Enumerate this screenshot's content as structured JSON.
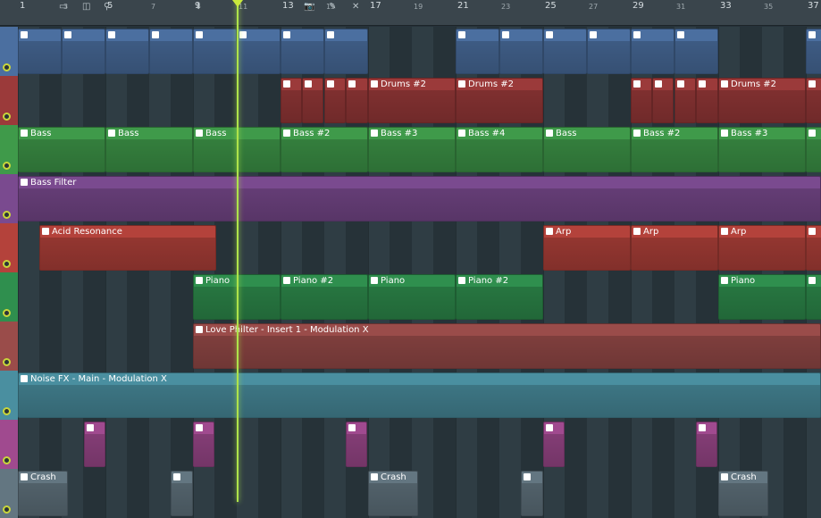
{
  "ruler": {
    "bars": [
      "1",
      "3",
      "5",
      "7",
      "9",
      "11",
      "13",
      "15",
      "17",
      "19",
      "21",
      "23",
      "25",
      "27",
      "29",
      "31",
      "33",
      "35",
      "37"
    ]
  },
  "tracks": [
    {
      "name": "track-1",
      "color": "#4b6fa0",
      "clips": [
        {
          "label": "",
          "start": 0,
          "len": 49
        },
        {
          "label": "",
          "start": 49,
          "len": 49
        },
        {
          "label": "",
          "start": 98,
          "len": 49
        },
        {
          "label": "",
          "start": 147,
          "len": 49
        },
        {
          "label": "",
          "start": 196,
          "len": 49
        },
        {
          "label": "",
          "start": 245,
          "len": 49
        },
        {
          "label": "",
          "start": 294,
          "len": 49
        },
        {
          "label": "",
          "start": 343,
          "len": 49
        },
        {
          "label": "",
          "start": 490,
          "len": 49
        },
        {
          "label": "",
          "start": 539,
          "len": 49
        },
        {
          "label": "",
          "start": 588,
          "len": 49
        },
        {
          "label": "",
          "start": 637,
          "len": 49
        },
        {
          "label": "",
          "start": 686,
          "len": 49
        },
        {
          "label": "",
          "start": 735,
          "len": 49
        },
        {
          "label": "",
          "start": 882,
          "len": 37
        }
      ]
    },
    {
      "name": "track-2",
      "color": "#9b3a3a",
      "clips": [
        {
          "label": "",
          "start": 294,
          "len": 24
        },
        {
          "label": "",
          "start": 318,
          "len": 24
        },
        {
          "label": "",
          "start": 343,
          "len": 24
        },
        {
          "label": "",
          "start": 367,
          "len": 25
        },
        {
          "label": "Drums #2",
          "start": 392,
          "len": 98
        },
        {
          "label": "Drums #2",
          "start": 490,
          "len": 98
        },
        {
          "label": "",
          "start": 686,
          "len": 24
        },
        {
          "label": "",
          "start": 710,
          "len": 24
        },
        {
          "label": "",
          "start": 735,
          "len": 24
        },
        {
          "label": "",
          "start": 759,
          "len": 25
        },
        {
          "label": "Drums #2",
          "start": 784,
          "len": 98
        },
        {
          "label": "",
          "start": 882,
          "len": 37
        }
      ]
    },
    {
      "name": "track-3",
      "color": "#3f9a4a",
      "clips": [
        {
          "label": "Bass",
          "start": 0,
          "len": 98
        },
        {
          "label": "Bass",
          "start": 98,
          "len": 98
        },
        {
          "label": "Bass",
          "start": 196,
          "len": 98
        },
        {
          "label": "Bass #2",
          "start": 294,
          "len": 98
        },
        {
          "label": "Bass #3",
          "start": 392,
          "len": 98
        },
        {
          "label": "Bass #4",
          "start": 490,
          "len": 98
        },
        {
          "label": "Bass",
          "start": 588,
          "len": 98
        },
        {
          "label": "Bass #2",
          "start": 686,
          "len": 98
        },
        {
          "label": "Bass #3",
          "start": 784,
          "len": 98
        },
        {
          "label": "",
          "start": 882,
          "len": 37
        }
      ]
    },
    {
      "name": "track-4",
      "color": "#7a4a8f",
      "clips": [
        {
          "label": "Bass Filter",
          "start": 0,
          "len": 899
        }
      ]
    },
    {
      "name": "track-5",
      "color": "#b4423b",
      "clips": [
        {
          "label": "Acid Resonance",
          "start": 24,
          "len": 198
        },
        {
          "label": "Arp",
          "start": 588,
          "len": 98
        },
        {
          "label": "Arp",
          "start": 686,
          "len": 98
        },
        {
          "label": "Arp",
          "start": 784,
          "len": 98
        },
        {
          "label": "",
          "start": 882,
          "len": 37
        }
      ]
    },
    {
      "name": "track-6",
      "color": "#2f8f4e",
      "clips": [
        {
          "label": "Piano",
          "start": 196,
          "len": 98
        },
        {
          "label": "Piano #2",
          "start": 294,
          "len": 98
        },
        {
          "label": "Piano",
          "start": 392,
          "len": 98
        },
        {
          "label": "Piano #2",
          "start": 490,
          "len": 98
        },
        {
          "label": "Piano",
          "start": 784,
          "len": 98
        },
        {
          "label": "",
          "start": 882,
          "len": 37
        }
      ]
    },
    {
      "name": "track-7",
      "color": "#9a4c4a",
      "clips": [
        {
          "label": "Love Philter - Insert 1 - Modulation X",
          "start": 196,
          "len": 703
        }
      ]
    },
    {
      "name": "track-8",
      "color": "#4a8fa0",
      "clips": [
        {
          "label": "Noise FX - Main - Modulation X",
          "start": 0,
          "len": 899
        }
      ]
    },
    {
      "name": "track-9",
      "color": "#a04a8f",
      "clips": [
        {
          "label": "",
          "start": 74,
          "len": 24
        },
        {
          "label": "",
          "start": 196,
          "len": 24
        },
        {
          "label": "",
          "start": 367,
          "len": 24
        },
        {
          "label": "",
          "start": 588,
          "len": 24
        },
        {
          "label": "",
          "start": 759,
          "len": 24
        }
      ]
    },
    {
      "name": "track-10",
      "color": "#637681",
      "clips": [
        {
          "label": "Crash",
          "start": 0,
          "len": 56
        },
        {
          "label": "",
          "start": 171,
          "len": 25
        },
        {
          "label": "Crash",
          "start": 392,
          "len": 56
        },
        {
          "label": "",
          "start": 563,
          "len": 25
        },
        {
          "label": "Crash",
          "start": 784,
          "len": 56
        }
      ]
    }
  ]
}
